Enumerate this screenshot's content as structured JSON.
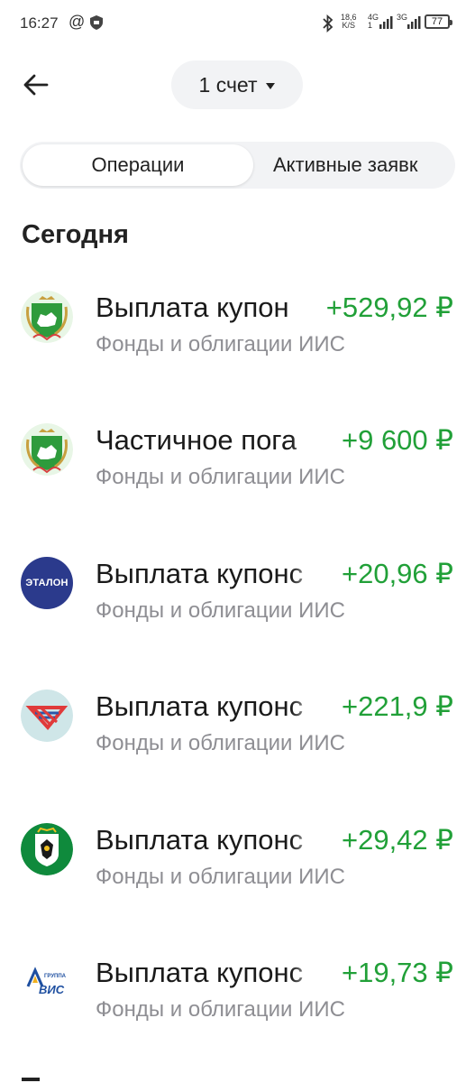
{
  "status_bar": {
    "time": "16:27",
    "at_symbol": "@",
    "speed_value": "18,6",
    "speed_unit": "K/S",
    "net1_label": "4G",
    "net1_sub": "1",
    "net2_label": "3G",
    "battery": "77"
  },
  "header": {
    "account_label": "1 счет"
  },
  "tabs": {
    "operations": "Операции",
    "active_requests": "Активные заявк"
  },
  "section_title": "Сегодня",
  "operations": [
    {
      "title": "Выплата купон",
      "amount": "+529,92 ₽",
      "subtitle": "Фонды и облигации ИИС",
      "logo": "tomsk-region-crest"
    },
    {
      "title": "Частичное пога",
      "amount": "+9 600 ₽",
      "subtitle": "Фонды и облигации ИИС",
      "logo": "tomsk-region-crest"
    },
    {
      "title": "Выплата купонс",
      "amount": "+20,96 ₽",
      "subtitle": "Фонды и облигации ИИС",
      "logo": "etalon-logo",
      "logo_text": "ЭТАЛОН"
    },
    {
      "title": "Выплата купонс",
      "amount": "+221,9 ₽",
      "subtitle": "Фонды и облигации ИИС",
      "logo": "red-arrows-logo"
    },
    {
      "title": "Выплата купонс",
      "amount": "+29,42 ₽",
      "subtitle": "Фонды и облигации ИИС",
      "logo": "novosibirsk-region-crest"
    },
    {
      "title": "Выплата купонс",
      "amount": "+19,73 ₽",
      "subtitle": "Фонды и облигации ИИС",
      "logo": "vis-group-logo",
      "logo_text": "ВИС",
      "logo_subtext": "ГРУППА"
    }
  ],
  "colors": {
    "positive_amount": "#21a038",
    "secondary_text": "#8e8e93",
    "pill_background": "#f2f3f5",
    "etalon_blue": "#2b3a8c",
    "novosibirsk_green": "#0f8a3c"
  }
}
